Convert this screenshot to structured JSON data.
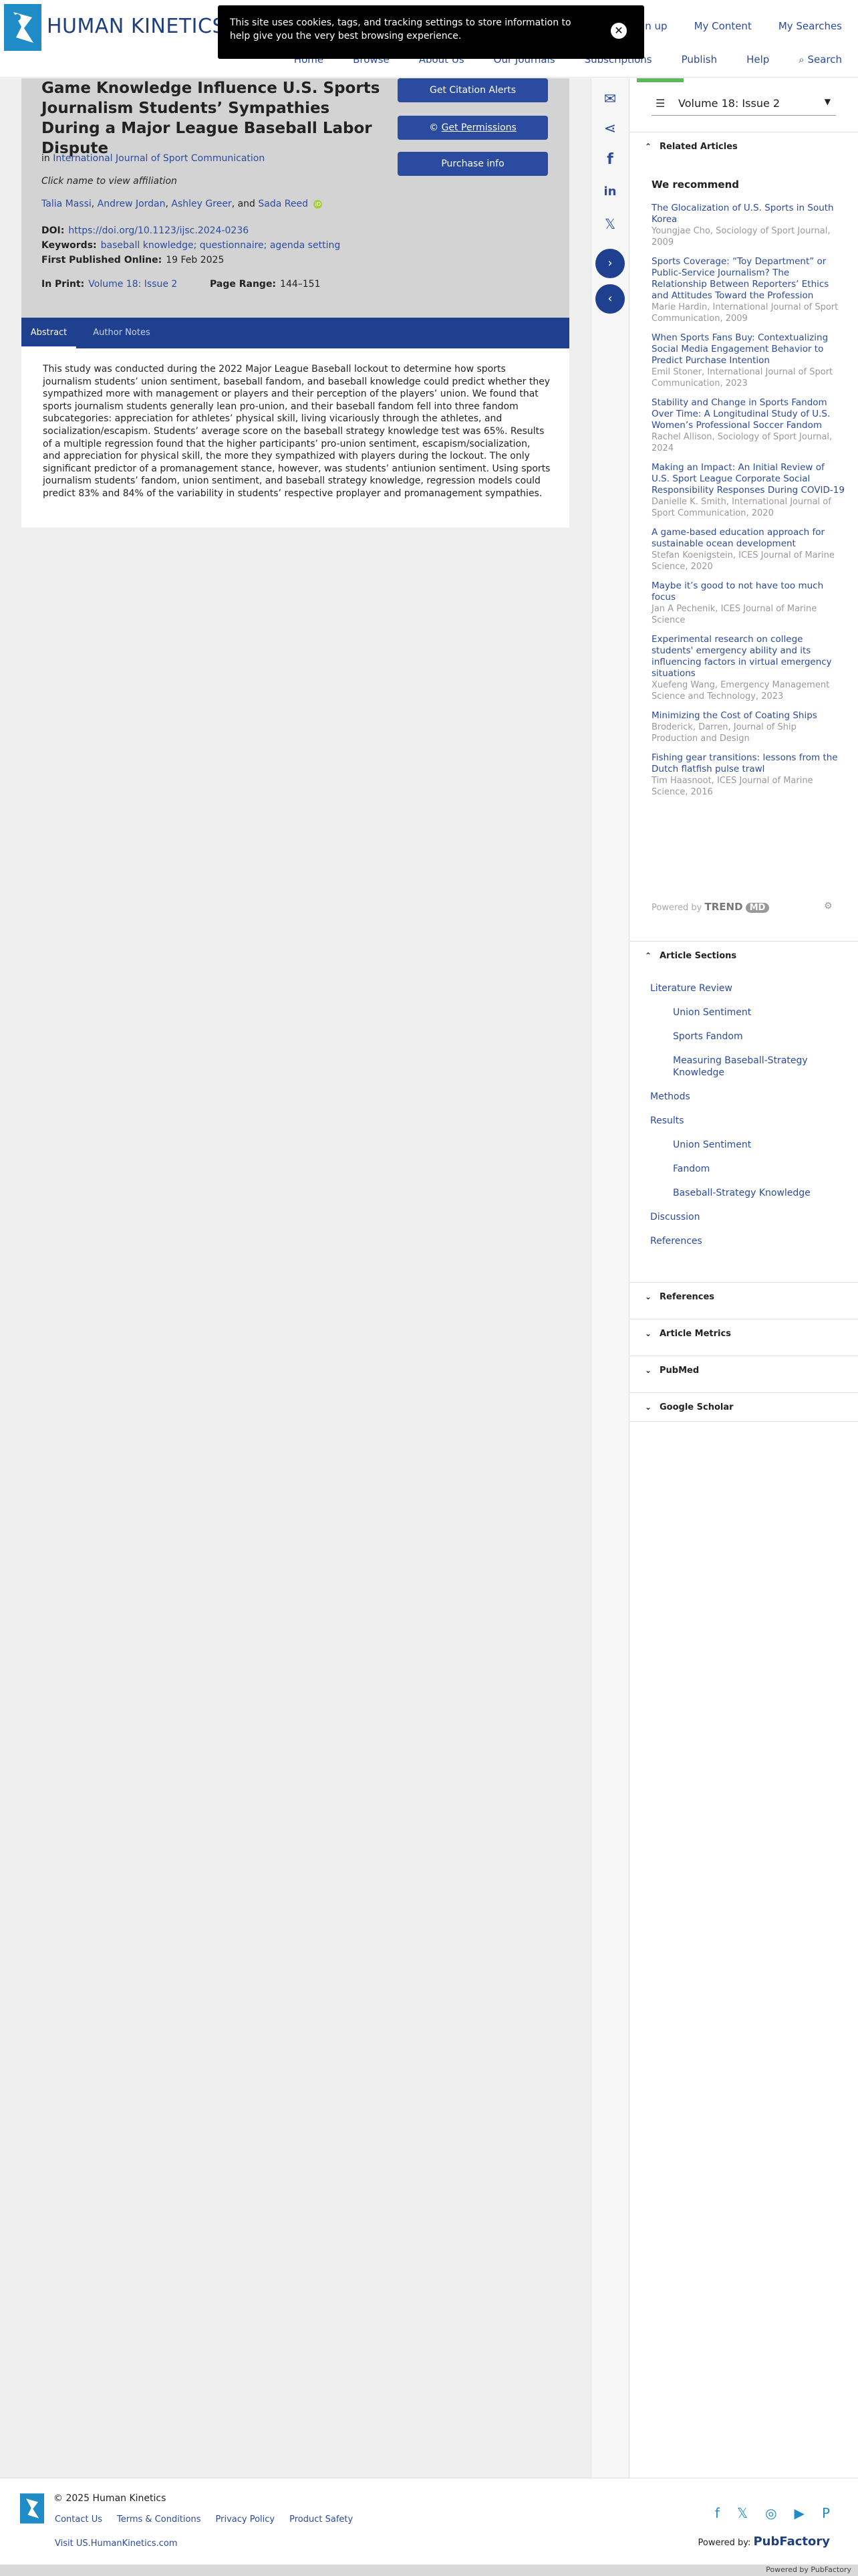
{
  "header": {
    "brand": "HUMAN KINETICS JO",
    "top_links": [
      "Sign up",
      "My Content",
      "My Searches"
    ],
    "nav": [
      "Home",
      "Browse",
      "About Us",
      "Our Journals",
      "Subscriptions",
      "Publish",
      "Help",
      "Search"
    ]
  },
  "cookie": {
    "text": "This site uses cookies, tags, and tracking settings to store information to help give you the very best browsing experience.",
    "close": "✕"
  },
  "article": {
    "title": "Game Knowledge Influence U.S. Sports Journalism Students’ Sympathies During a Major League Baseball Labor Dispute",
    "journal_prefix": "in",
    "journal": "International Journal of Sport Communication",
    "click_affil": "Click name to view affiliation",
    "authors": [
      "Talia Massi",
      "Andrew Jordan",
      "Ashley Greer",
      "Sada Reed"
    ],
    "author_sep": ", ",
    "author_and": ", and ",
    "doi_label": "DOI:",
    "doi": "https://doi.org/10.1123/ijsc.2024-0236",
    "keywords_label": "Keywords:",
    "keywords": "baseball knowledge; questionnaire; agenda setting",
    "first_pub_label": "First Published Online:",
    "first_pub": "19 Feb 2025",
    "in_print_label": "In Print:",
    "in_print": "Volume 18: Issue 2",
    "page_range_label": "Page Range:",
    "page_range": "144–151",
    "buttons": {
      "citation": "Get Citation Alerts",
      "permissions": "Get Permissions",
      "purchase": "Purchase info"
    }
  },
  "tabs": [
    "Abstract",
    "Author Notes"
  ],
  "abstract": "This study was conducted during the 2022 Major League Baseball lockout to determine how sports journalism students’ union sentiment, baseball fandom, and baseball knowledge could predict whether they sympathized more with management or players and their perception of the players’ union. We found that sports journalism students generally lean pro-union, and their baseball fandom fell into three fandom subcategories: appreciation for athletes’ physical skill, living vicariously through the athletes, and socialization/escapism. Students’ average score on the baseball strategy knowledge test was 65%. Results of a multiple regression found that the higher participants’ pro-union sentiment, escapism/socialization, and appreciation for physical skill, the more they sympathized with players during the lockout. The only significant predictor of a promanagement stance, however, was students’ antiunion sentiment. Using sports journalism students’ fandom, union sentiment, and baseball strategy knowledge, regression models could predict 83% and 84% of the variability in students’ respective proplayer and promanagement sympathies.",
  "sidebar": {
    "volume": "Volume 18: Issue 2",
    "related_articles": "Related Articles",
    "we_recommend": "We recommend",
    "recommendations": [
      {
        "title": "The Glocalization of U.S. Sports in South Korea",
        "source": "Youngjae Cho, Sociology of Sport Journal, 2009"
      },
      {
        "title": "Sports Coverage: “Toy Department” or Public-Service Journalism? The Relationship Between Reporters’ Ethics and Attitudes Toward the Profession",
        "source": "Marie Hardin, International Journal of Sport Communication, 2009"
      },
      {
        "title": "When Sports Fans Buy: Contextualizing Social Media Engagement Behavior to Predict Purchase Intention",
        "source": "Emil Stoner, International Journal of Sport Communication, 2023"
      },
      {
        "title": "Stability and Change in Sports Fandom Over Time: A Longitudinal Study of U.S. Women’s Professional Soccer Fandom",
        "source": "Rachel Allison, Sociology of Sport Journal, 2024"
      },
      {
        "title": "Making an Impact: An Initial Review of U.S. Sport League Corporate Social Responsibility Responses During COVID-19",
        "source": "Danielle K. Smith, International Journal of Sport Communication, 2020"
      },
      {
        "title": "A game-based education approach for sustainable ocean development",
        "source": "Stefan Koenigstein, ICES Journal of Marine Science, 2020"
      },
      {
        "title": "Maybe it’s good to not have too much focus",
        "source": "Jan A Pechenik, ICES Journal of Marine Science"
      },
      {
        "title": "Experimental research on college students' emergency ability and its influencing factors in virtual emergency situations",
        "source": "Xuefeng Wang, Emergency Management Science and Technology, 2023"
      },
      {
        "title": "Minimizing the Cost of Coating Ships",
        "source": "Broderick, Darren, Journal of Ship Production and Design"
      },
      {
        "title": "Fishing gear transitions: lessons from the Dutch flatfish pulse trawl",
        "source": "Tim Haasnoot, ICES Journal of Marine Science, 2016"
      }
    ],
    "powered_by": "Powered by",
    "trend": "TREND",
    "md": "MD",
    "article_sections": "Article Sections",
    "sections": [
      {
        "label": "Literature Review",
        "level": 0
      },
      {
        "label": "Union Sentiment",
        "level": 1
      },
      {
        "label": "Sports Fandom",
        "level": 1
      },
      {
        "label": "Measuring Baseball-Strategy Knowledge",
        "level": 1
      },
      {
        "label": "Methods",
        "level": 0
      },
      {
        "label": "Results",
        "level": 0
      },
      {
        "label": "Union Sentiment",
        "level": 1
      },
      {
        "label": "Fandom",
        "level": 1
      },
      {
        "label": "Baseball-Strategy Knowledge",
        "level": 1
      },
      {
        "label": "Discussion",
        "level": 0
      },
      {
        "label": "References",
        "level": 0
      }
    ],
    "collapsed": [
      "References",
      "Article Metrics",
      "PubMed",
      "Google Scholar"
    ]
  },
  "footer": {
    "copyright": "© 2025 Human Kinetics",
    "links": [
      "Contact Us",
      "Terms & Conditions",
      "Privacy Policy",
      "Product Safety"
    ],
    "visit": "Visit US.HumanKinetics.com",
    "powered_by": "Powered by:",
    "pubfactory": "PubFactory",
    "bottom_bar": "Powered by PubFactory"
  },
  "colors": {
    "accent": "#2b4ba0",
    "nav_dark": "#1f3f8f"
  }
}
